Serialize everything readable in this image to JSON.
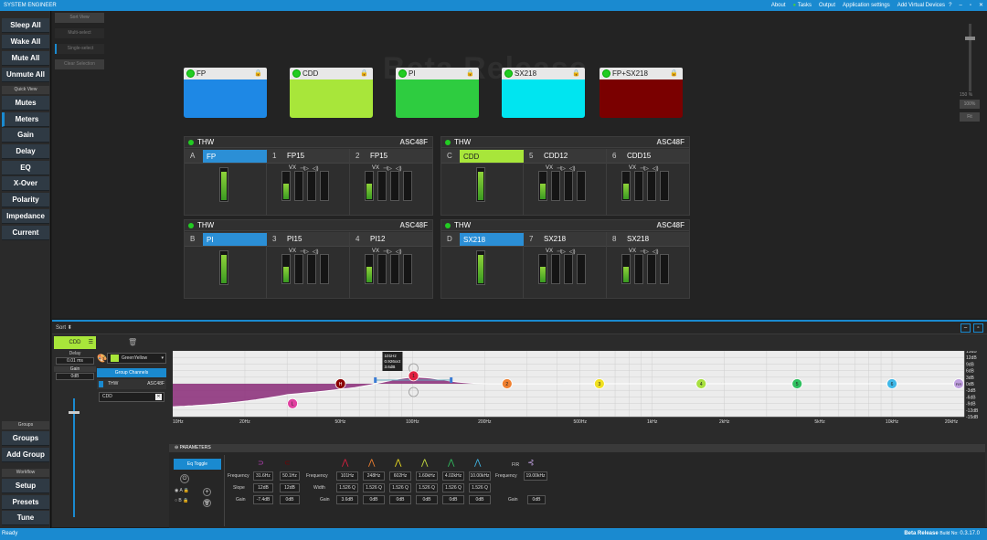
{
  "app": {
    "title": "SYSTEM ENGINEER"
  },
  "menu": [
    "About",
    "Tasks",
    "Output",
    "Application settings",
    "Add Virtual Devices"
  ],
  "window_controls": [
    "?",
    "–",
    "▫",
    "✕"
  ],
  "sidebar": {
    "actions": [
      "Sleep All",
      "Wake All",
      "Mute All",
      "Unmute All"
    ],
    "quick_view_label": "Quick View",
    "views": [
      "Mutes",
      "Meters",
      "Gain",
      "Delay",
      "EQ",
      "X-Over",
      "Polarity",
      "Impedance",
      "Current"
    ],
    "groups_label": "Groups",
    "groups_buttons": [
      "Groups",
      "Add Group"
    ],
    "workflow_label": "Workflow",
    "workflow_buttons": [
      "Setup",
      "Presets",
      "Tune"
    ]
  },
  "view_tools": [
    "Sort View",
    "Multi-select",
    "Single-select",
    "Clear Selection"
  ],
  "watermark": "Beta Release",
  "zoom": {
    "level": "150 %",
    "btn_fit": "100%",
    "btn_fill": "Fit"
  },
  "groups": [
    {
      "name": "FP",
      "color": "#1e88e5"
    },
    {
      "name": "CDD",
      "color": "#a8e63a"
    },
    {
      "name": "PI",
      "color": "#2ecc40"
    },
    {
      "name": "SX218",
      "color": "#00e5f0"
    },
    {
      "name": "FP+SX218",
      "color": "#7a0000"
    }
  ],
  "amps": [
    {
      "name": "THW",
      "model": "ASC48F",
      "channels": [
        {
          "idx": "A",
          "name": "FP",
          "hl": "#2b8fd6"
        },
        {
          "idx": "1",
          "name": "FP15"
        },
        {
          "idx": "2",
          "name": "FP15"
        }
      ]
    },
    {
      "name": "THW",
      "model": "ASC48F",
      "channels": [
        {
          "idx": "C",
          "name": "CDD",
          "hl": "#a8e63a"
        },
        {
          "idx": "5",
          "name": "CDD12"
        },
        {
          "idx": "6",
          "name": "CDD15"
        }
      ]
    },
    {
      "name": "THW",
      "model": "ASC48F",
      "channels": [
        {
          "idx": "B",
          "name": "PI",
          "hl": "#2b8fd6"
        },
        {
          "idx": "3",
          "name": "PI15"
        },
        {
          "idx": "4",
          "name": "PI12"
        }
      ]
    },
    {
      "name": "THW",
      "model": "ASC48F",
      "channels": [
        {
          "idx": "D",
          "name": "SX218",
          "hl": "#2b8fd6"
        },
        {
          "idx": "7",
          "name": "SX218"
        },
        {
          "idx": "8",
          "name": "SX218"
        }
      ]
    }
  ],
  "vx_label": "VX",
  "bottom": {
    "sort_label": "Sort",
    "channel": {
      "name": "CDD",
      "delay_label": "Delay",
      "delay": "0.01 ms",
      "gain_label": "Gain",
      "gain": "0dB"
    },
    "color_name": "GreenYellow",
    "group_channels_label": "Group Channels",
    "group_row": {
      "amp": "THW",
      "model": "ASC48F"
    },
    "group_item": "CDD"
  },
  "eq": {
    "freq_ticks": [
      "10Hz",
      "20Hz",
      "50Hz",
      "100Hz",
      "200Hz",
      "500Hz",
      "1kHz",
      "2kHz",
      "5kHz",
      "10kHz",
      "20kHz"
    ],
    "db_ticks": [
      "15dB",
      "12dB",
      "9dB",
      "6dB",
      "3dB",
      "0dB",
      "-3dB",
      "-6dB",
      "-9dB",
      "-12dB",
      "-15dB"
    ],
    "tooltip": [
      "101Hz",
      "0.926oct",
      "3.6dB"
    ],
    "nodes": [
      {
        "label": "L",
        "color": "#e040a0"
      },
      {
        "label": "H",
        "color": "#8b0000"
      },
      {
        "label": "1",
        "color": "#e02040"
      },
      {
        "label": "2",
        "color": "#f08030"
      },
      {
        "label": "3",
        "color": "#f0e020"
      },
      {
        "label": "4",
        "color": "#a8e040"
      },
      {
        "label": "5",
        "color": "#30c060"
      },
      {
        "label": "6",
        "color": "#40b8e8"
      },
      {
        "label": "FIR",
        "color": "#c0a0e0"
      }
    ]
  },
  "params": {
    "title": "PARAMETERS",
    "eq_toggle": "Eq Toggle",
    "ab": [
      "A",
      "B"
    ],
    "labels": {
      "frequency": "Frequency",
      "slope": "Slope",
      "gain": "Gain",
      "width": "Width",
      "fir": "FIR"
    },
    "hp": {
      "frequency": "31.6Hz",
      "slope": "12dB",
      "gain": "-7.4dB"
    },
    "lp": {
      "frequency": "50.1Hz",
      "slope": "12dB",
      "gain": "0dB"
    },
    "bands": [
      {
        "frequency": "101Hz",
        "width": "1.526 Q",
        "gain": "3.6dB",
        "color": "#e02040"
      },
      {
        "frequency": "248Hz",
        "width": "1.526 Q",
        "gain": "0dB",
        "color": "#f08030"
      },
      {
        "frequency": "602Hz",
        "width": "1.526 Q",
        "gain": "0dB",
        "color": "#f0e020"
      },
      {
        "frequency": "1.60kHz",
        "width": "1.526 Q",
        "gain": "0dB",
        "color": "#c8e040"
      },
      {
        "frequency": "4.02kHz",
        "width": "1.526 Q",
        "gain": "0dB",
        "color": "#30c060"
      },
      {
        "frequency": "10.00kHz",
        "width": "1.526 Q",
        "gain": "0dB",
        "color": "#40b8e8"
      }
    ],
    "fir": {
      "frequency": "19.00kHz",
      "gain": "0dB"
    }
  },
  "status": {
    "left": "Ready",
    "right_bold": "Beta Release",
    "build_label": "Build No:",
    "build": "0.3.17.0"
  }
}
